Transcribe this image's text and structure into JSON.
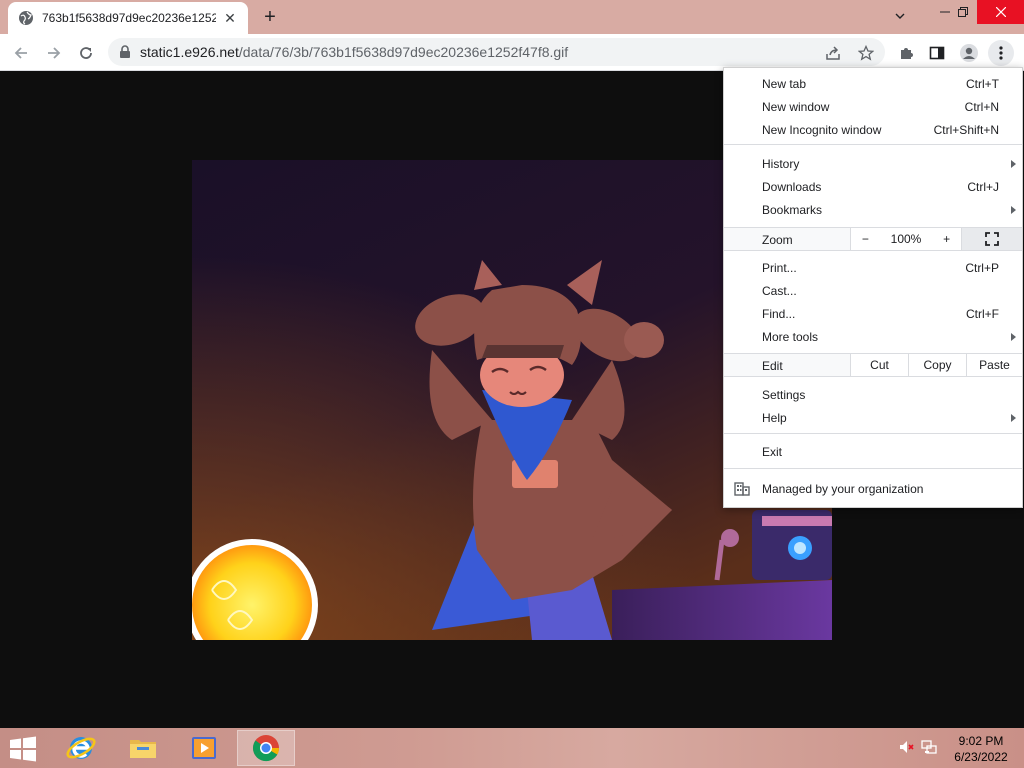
{
  "browser": {
    "tab": {
      "title": "763b1f5638d97d9ec20236e1252f47f8.gif"
    },
    "address": {
      "host": "static1.e926.net",
      "path": "/data/76/3b/763b1f5638d97d9ec20236e1252f47f8.gif"
    }
  },
  "menu": {
    "items": [
      {
        "label": "New tab",
        "shortcut": "Ctrl+T"
      },
      {
        "label": "New window",
        "shortcut": "Ctrl+N"
      },
      {
        "label": "New Incognito window",
        "shortcut": "Ctrl+Shift+N"
      },
      {
        "label": "History",
        "shortcut": ""
      },
      {
        "label": "Downloads",
        "shortcut": "Ctrl+J"
      },
      {
        "label": "Bookmarks",
        "shortcut": ""
      },
      {
        "label": "Print...",
        "shortcut": "Ctrl+P"
      },
      {
        "label": "Cast...",
        "shortcut": ""
      },
      {
        "label": "Find...",
        "shortcut": "Ctrl+F"
      },
      {
        "label": "More tools",
        "shortcut": ""
      },
      {
        "label": "Settings",
        "shortcut": ""
      },
      {
        "label": "Help",
        "shortcut": ""
      },
      {
        "label": "Exit",
        "shortcut": ""
      }
    ],
    "zoom": {
      "label": "Zoom",
      "minus": "−",
      "value": "100%",
      "plus": "+"
    },
    "edit": {
      "label": "Edit",
      "cut": "Cut",
      "copy": "Copy",
      "paste": "Paste"
    },
    "managed": "Managed by your organization"
  },
  "taskbar": {
    "clock": {
      "time": "9:02 PM",
      "date": "6/23/2022"
    }
  },
  "colors": {
    "tabstrip": "#d8aba3",
    "close_button": "#e81123",
    "menu_bg": "#ffffff"
  }
}
